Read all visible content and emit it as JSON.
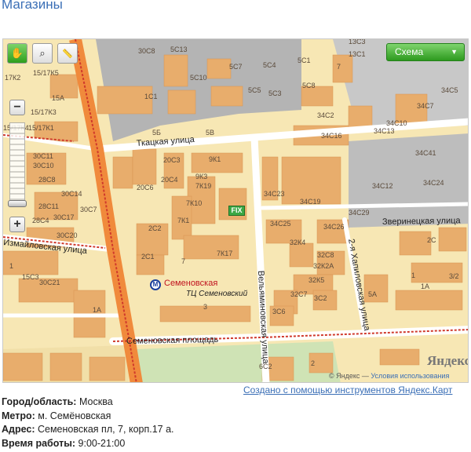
{
  "page": {
    "title": "Магазины",
    "created_link": "Создано с помощью инструментов Яндекс.Карт"
  },
  "map": {
    "tools": [
      {
        "icon": "hand-icon",
        "glyph": "✋",
        "active": true
      },
      {
        "icon": "magnifier-icon",
        "glyph": "⌕",
        "active": false
      },
      {
        "icon": "ruler-icon",
        "glyph": "📏",
        "active": false
      }
    ],
    "zoom_in": "+",
    "zoom_out": "−",
    "scheme_label": "Схема",
    "metro_station": "Семеновская",
    "mall_name": "ТЦ Семеновский",
    "marker_label": "FIX",
    "copyright_prefix": "© Яндекс",
    "copyright_link": "Условия использования",
    "yandex_logo": "Яндекс",
    "streets": {
      "tkatskaya": "Ткацкая улица",
      "izmailovskaya": "Измайловская улица",
      "semenovskaya_ploshchad": "Семеновская площадь",
      "velyaminovskaya": "Вельяминовская улица",
      "khapilovskaya": "2-я Хапиловская улица",
      "zverinetskaya": "Зверинецкая улица"
    },
    "building_labels": [
      "30С8",
      "5С13",
      "5С7",
      "5С4",
      "5С1",
      "7",
      "13С3",
      "13С1",
      "17К2",
      "15/17К5",
      "5С10",
      "5С5",
      "5С3",
      "5С8",
      "15А",
      "1С1",
      "34С7",
      "34С5",
      "15/17К3",
      "34С2",
      "34С10",
      "15/17К1",
      "15/17К4",
      "5Б",
      "5В",
      "34С16",
      "34С13",
      "30С11",
      "9К1",
      "34С41",
      "30С10",
      "20С3",
      "9К3",
      "34С23",
      "34С12",
      "34С24",
      "28С8",
      "20С4",
      "7К19",
      "34С19",
      "30С14",
      "20С6",
      "7К10",
      "7К1",
      "34С29",
      "28С11",
      "30С7",
      "30С17",
      "28С4",
      "30С20",
      "34С25",
      "34С26",
      "2С2",
      "32К4",
      "32С8",
      "1",
      "2С1",
      "7",
      "7К17",
      "32К2А",
      "15С3",
      "30С21",
      "32К5",
      "5А",
      "32С7",
      "3С2",
      "1А",
      "3С6",
      "1А",
      "2С",
      "6С2",
      "2",
      "1",
      "3",
      "3/2"
    ]
  },
  "info": {
    "city_label": "Город/область:",
    "city_value": "Москва",
    "metro_label": "Метро:",
    "metro_value": "м. Семёновская",
    "address_label": "Адрес:",
    "address_value": "Семеновская пл, 7, корп.17 а.",
    "hours_label": "Время работы:",
    "hours_value": "9:00-21:00"
  }
}
